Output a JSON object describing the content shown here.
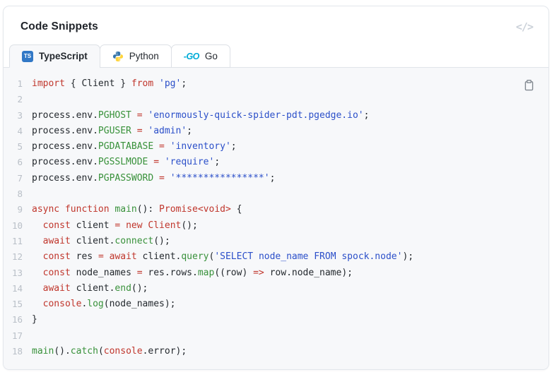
{
  "header": {
    "title": "Code Snippets",
    "code_icon": "</>"
  },
  "tabs": [
    {
      "label": "TypeScript",
      "icon": "typescript-icon",
      "icon_text": "TS",
      "active": true
    },
    {
      "label": "Python",
      "icon": "python-icon",
      "active": false
    },
    {
      "label": "Go",
      "icon": "go-icon",
      "icon_text": "-GO",
      "active": false
    }
  ],
  "colors": {
    "keyword": "#c0362c",
    "string": "#2b4fc9",
    "name": "#38913a",
    "plain": "#24292e",
    "linenum": "#b9bfc7",
    "codebg": "#f7f8fa",
    "ts_blue": "#3178c6",
    "python_blue": "#3776ab",
    "python_yellow": "#ffd43b",
    "go_cyan": "#00acd7"
  },
  "editor": {
    "copy_icon": "clipboard",
    "lines": [
      {
        "number": "1",
        "tokens": [
          [
            "k",
            "import"
          ],
          [
            "p",
            " { Client } "
          ],
          [
            "k",
            "from"
          ],
          [
            "p",
            " "
          ],
          [
            "s",
            "'pg'"
          ],
          [
            "p",
            ";"
          ]
        ]
      },
      {
        "number": "2",
        "tokens": []
      },
      {
        "number": "3",
        "tokens": [
          [
            "p",
            "process.env."
          ],
          [
            "g",
            "PGHOST"
          ],
          [
            "p",
            " "
          ],
          [
            "k",
            "="
          ],
          [
            "p",
            " "
          ],
          [
            "s",
            "'enormously-quick-spider-pdt.pgedge.io'"
          ],
          [
            "p",
            ";"
          ]
        ]
      },
      {
        "number": "4",
        "tokens": [
          [
            "p",
            "process.env."
          ],
          [
            "g",
            "PGUSER"
          ],
          [
            "p",
            " "
          ],
          [
            "k",
            "="
          ],
          [
            "p",
            " "
          ],
          [
            "s",
            "'admin'"
          ],
          [
            "p",
            ";"
          ]
        ]
      },
      {
        "number": "5",
        "tokens": [
          [
            "p",
            "process.env."
          ],
          [
            "g",
            "PGDATABASE"
          ],
          [
            "p",
            " "
          ],
          [
            "k",
            "="
          ],
          [
            "p",
            " "
          ],
          [
            "s",
            "'inventory'"
          ],
          [
            "p",
            ";"
          ]
        ]
      },
      {
        "number": "6",
        "tokens": [
          [
            "p",
            "process.env."
          ],
          [
            "g",
            "PGSSLMODE"
          ],
          [
            "p",
            " "
          ],
          [
            "k",
            "="
          ],
          [
            "p",
            " "
          ],
          [
            "s",
            "'require'"
          ],
          [
            "p",
            ";"
          ]
        ]
      },
      {
        "number": "7",
        "tokens": [
          [
            "p",
            "process.env."
          ],
          [
            "g",
            "PGPASSWORD"
          ],
          [
            "p",
            " "
          ],
          [
            "k",
            "="
          ],
          [
            "p",
            " "
          ],
          [
            "s",
            "'****************'"
          ],
          [
            "p",
            ";"
          ]
        ]
      },
      {
        "number": "8",
        "tokens": []
      },
      {
        "number": "9",
        "tokens": [
          [
            "k",
            "async"
          ],
          [
            "p",
            " "
          ],
          [
            "k",
            "function"
          ],
          [
            "p",
            " "
          ],
          [
            "g",
            "main"
          ],
          [
            "p",
            "(): "
          ],
          [
            "k",
            "Promise<void>"
          ],
          [
            "p",
            " {"
          ]
        ]
      },
      {
        "number": "10",
        "tokens": [
          [
            "p",
            "  "
          ],
          [
            "k",
            "const"
          ],
          [
            "p",
            " client "
          ],
          [
            "k",
            "="
          ],
          [
            "p",
            " "
          ],
          [
            "k",
            "new"
          ],
          [
            "p",
            " "
          ],
          [
            "k",
            "Client"
          ],
          [
            "p",
            "();"
          ]
        ]
      },
      {
        "number": "11",
        "tokens": [
          [
            "p",
            "  "
          ],
          [
            "k",
            "await"
          ],
          [
            "p",
            " client."
          ],
          [
            "g",
            "connect"
          ],
          [
            "p",
            "();"
          ]
        ]
      },
      {
        "number": "12",
        "tokens": [
          [
            "p",
            "  "
          ],
          [
            "k",
            "const"
          ],
          [
            "p",
            " res "
          ],
          [
            "k",
            "="
          ],
          [
            "p",
            " "
          ],
          [
            "k",
            "await"
          ],
          [
            "p",
            " client."
          ],
          [
            "g",
            "query"
          ],
          [
            "p",
            "("
          ],
          [
            "s",
            "'SELECT node_name FROM spock.node'"
          ],
          [
            "p",
            ");"
          ]
        ]
      },
      {
        "number": "13",
        "tokens": [
          [
            "p",
            "  "
          ],
          [
            "k",
            "const"
          ],
          [
            "p",
            " node_names "
          ],
          [
            "k",
            "="
          ],
          [
            "p",
            " res.rows."
          ],
          [
            "g",
            "map"
          ],
          [
            "p",
            "((row) "
          ],
          [
            "k",
            "=>"
          ],
          [
            "p",
            " row.node_name);"
          ]
        ]
      },
      {
        "number": "14",
        "tokens": [
          [
            "p",
            "  "
          ],
          [
            "k",
            "await"
          ],
          [
            "p",
            " client."
          ],
          [
            "g",
            "end"
          ],
          [
            "p",
            "();"
          ]
        ]
      },
      {
        "number": "15",
        "tokens": [
          [
            "p",
            "  "
          ],
          [
            "k",
            "console"
          ],
          [
            "p",
            "."
          ],
          [
            "g",
            "log"
          ],
          [
            "p",
            "(node_names);"
          ]
        ]
      },
      {
        "number": "16",
        "tokens": [
          [
            "p",
            "}"
          ]
        ]
      },
      {
        "number": "17",
        "tokens": []
      },
      {
        "number": "18",
        "tokens": [
          [
            "g",
            "main"
          ],
          [
            "p",
            "()."
          ],
          [
            "g",
            "catch"
          ],
          [
            "p",
            "("
          ],
          [
            "k",
            "console"
          ],
          [
            "p",
            ".error);"
          ]
        ]
      }
    ]
  }
}
